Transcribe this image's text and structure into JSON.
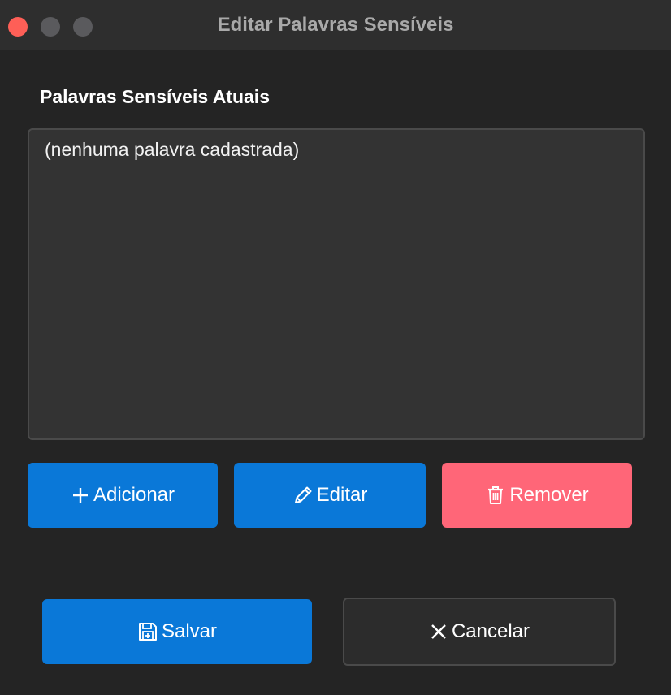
{
  "window": {
    "title": "Editar Palavras Sensíveis",
    "controls": [
      "close",
      "minimize",
      "maximize"
    ]
  },
  "section": {
    "label": "Palavras Sensíveis Atuais"
  },
  "list": {
    "items": [
      "(nenhuma palavra cadastrada)"
    ]
  },
  "actions": {
    "add_label": "Adicionar",
    "add_icon": "plus-icon",
    "edit_label": "Editar",
    "edit_icon": "pencil-icon",
    "remove_label": "Remover",
    "remove_icon": "trash-icon"
  },
  "footer": {
    "save_label": "Salvar",
    "save_icon": "floppy-disk-icon",
    "cancel_label": "Cancelar",
    "cancel_icon": "x-icon"
  },
  "colors": {
    "primary": "#0a78d8",
    "danger": "#ff6678",
    "background": "#242424",
    "close_dot": "#fe5f57"
  }
}
